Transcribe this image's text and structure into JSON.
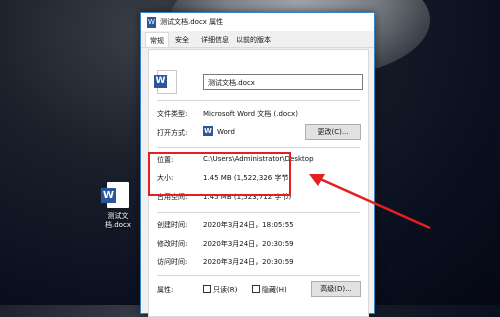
{
  "desktop": {
    "icon_label": "测试文档.docx"
  },
  "dialog": {
    "title": "测试文档.docx 属性",
    "tabs": [
      "常规",
      "安全",
      "详细信息",
      "以前的版本"
    ],
    "file_name": "测试文档.docx",
    "rows": {
      "file_type_label": "文件类型:",
      "file_type_value": "Microsoft Word 文档 (.docx)",
      "open_with_label": "打开方式:",
      "open_with_value": "Word",
      "change_button": "更改(C)...",
      "location_label": "位置:",
      "location_value": "C:\\Users\\Administrator\\Desktop",
      "size_label": "大小:",
      "size_value": "1.45 MB (1,522,326 字节)",
      "size_on_disk_label": "占用空间:",
      "size_on_disk_value": "1.45 MB (1,523,712 字节)",
      "created_label": "创建时间:",
      "created_value": "2020年3月24日，18:05:55",
      "modified_label": "修改时间:",
      "modified_value": "2020年3月24日，20:30:59",
      "accessed_label": "访问时间:",
      "accessed_value": "2020年3月24日，20:30:59",
      "attributes_label": "属性:",
      "readonly_label": "只读(R)",
      "hidden_label": "隐藏(H)",
      "advanced_button": "高级(D)..."
    }
  },
  "colors": {
    "highlight": "#e31f1f",
    "word_blue": "#2b579a"
  }
}
